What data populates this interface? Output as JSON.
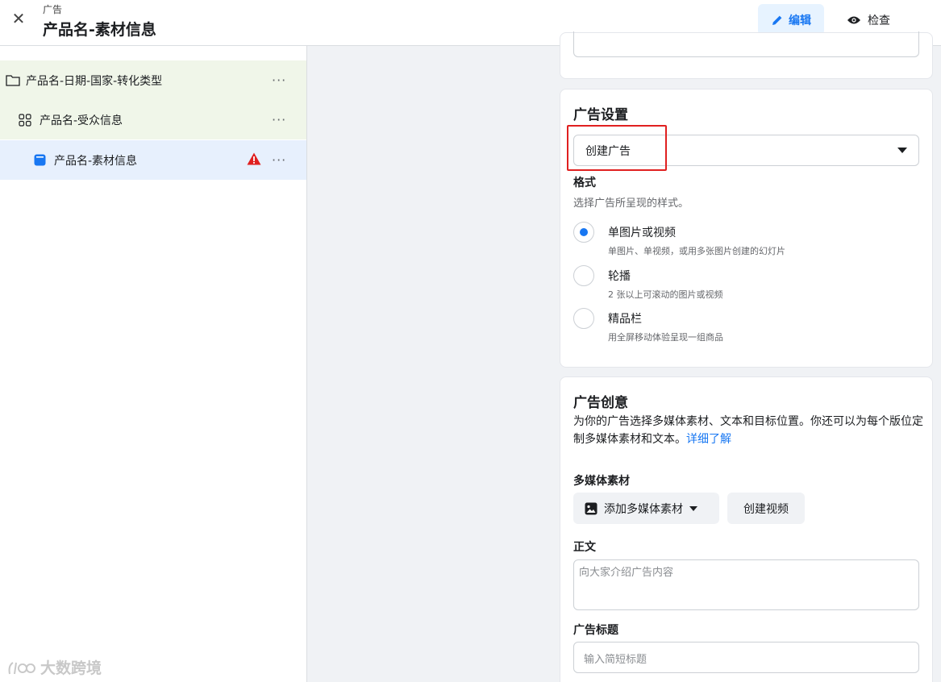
{
  "header": {
    "close_icon": "close-icon",
    "breadcrumb": "广告",
    "title": "产品名-素材信息",
    "edit_label": "编辑",
    "review_label": "检查"
  },
  "tree": [
    {
      "label": "产品名-日期-国家-转化类型",
      "icon": "folder-icon",
      "more": "···"
    },
    {
      "label": "产品名-受众信息",
      "icon": "grid-icon",
      "more": "···"
    },
    {
      "label": "产品名-素材信息",
      "icon": "ad-icon",
      "more": "···",
      "warning": true
    }
  ],
  "watermark": "大数跨境",
  "ad_settings": {
    "title": "广告设置",
    "select_value": "创建广告",
    "format_label": "格式",
    "format_hint": "选择广告所呈现的样式。",
    "options": [
      {
        "title": "单图片或视频",
        "desc": "单图片、单视频，或用多张图片创建的幻灯片",
        "selected": true
      },
      {
        "title": "轮播",
        "desc": "2 张以上可滚动的图片或视频",
        "selected": false
      },
      {
        "title": "精品栏",
        "desc": "用全屏移动体验呈现一组商品",
        "selected": false
      }
    ]
  },
  "ad_creative": {
    "title": "广告创意",
    "desc": "为你的广告选择多媒体素材、文本和目标位置。你还可以为每个版位定制多媒体素材和文本。",
    "learn_more": "详细了解",
    "media_label": "多媒体素材",
    "add_media": "添加多媒体素材",
    "create_video": "创建视频",
    "body_label": "正文",
    "body_placeholder": "向大家介绍广告内容",
    "headline_label": "广告标题",
    "headline_placeholder": "输入简短标题"
  },
  "colors": {
    "accent": "#1877f2",
    "warning": "#e02020",
    "highlight_box": "#e02020"
  }
}
